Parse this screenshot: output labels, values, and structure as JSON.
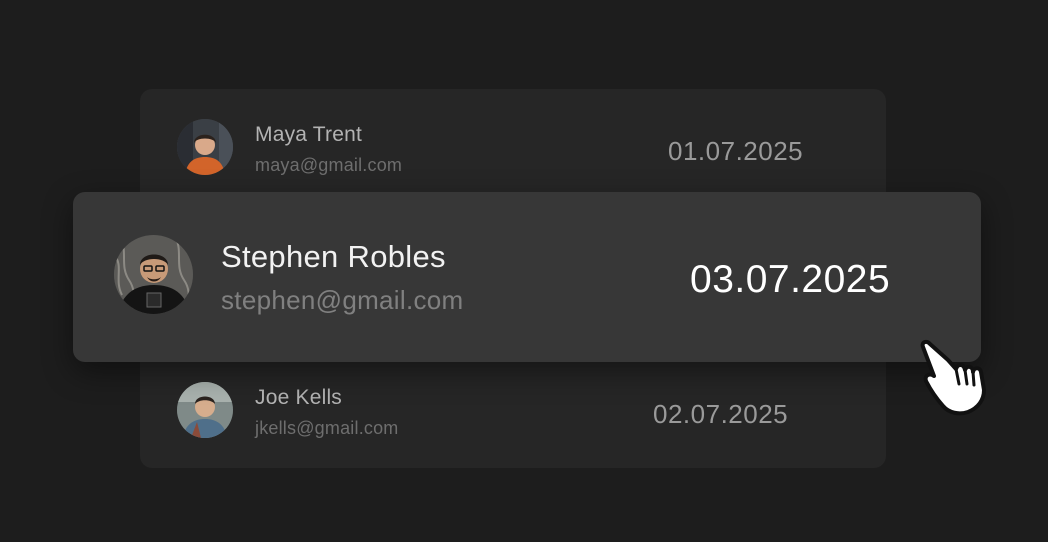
{
  "users": {
    "maya": {
      "name": "Maya Trent",
      "email": "maya@gmail.com",
      "date": "01.07.2025",
      "avatar_icon": "avatar-photo"
    },
    "stephen": {
      "name": "Stephen Robles",
      "email": "stephen@gmail.com",
      "date": "03.07.2025",
      "avatar_icon": "avatar-photo"
    },
    "joe": {
      "name": "Joe Kells",
      "email": "jkells@gmail.com",
      "date": "02.07.2025",
      "avatar_icon": "avatar-photo"
    }
  },
  "cursor": {
    "icon": "hand-pointer-icon"
  },
  "colors": {
    "background": "#1d1d1d",
    "card": "#262626",
    "highlight": "#373737"
  }
}
